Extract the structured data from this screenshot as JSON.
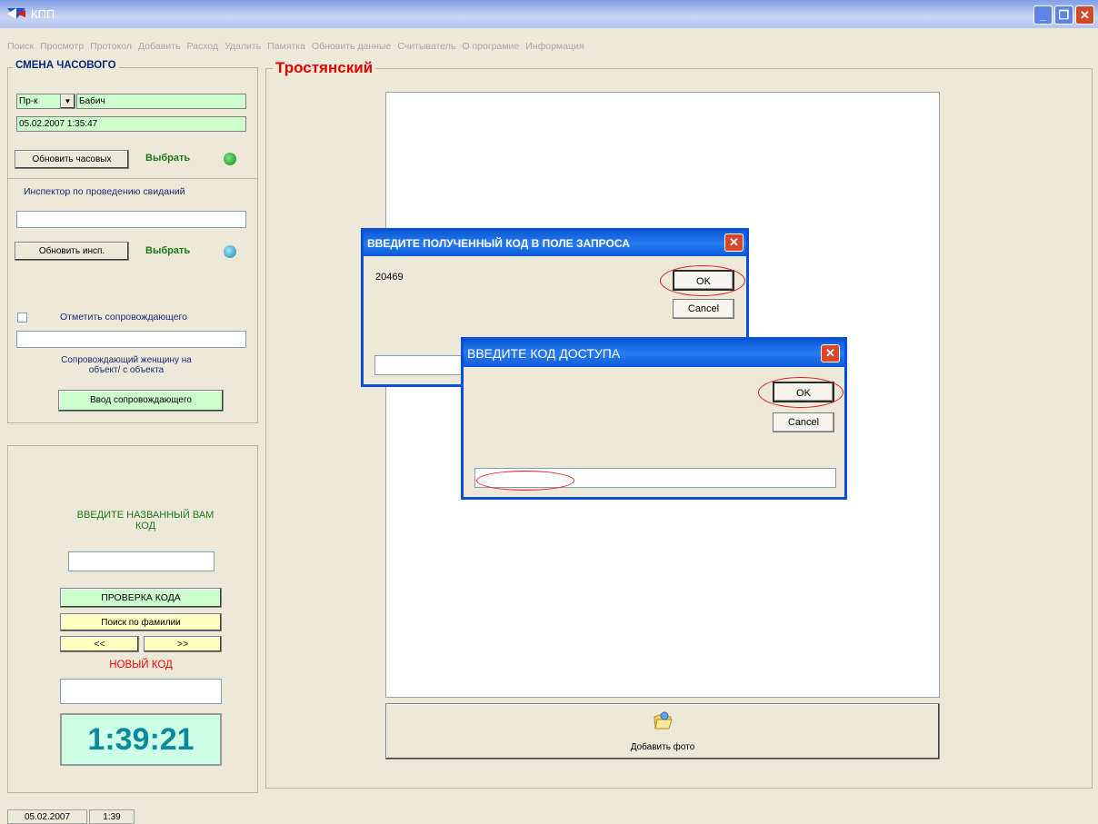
{
  "window": {
    "title": "КПП"
  },
  "menu": [
    "Поиск",
    "Просмотр",
    "Протокол",
    "Добавить",
    "Расход",
    "Удалить",
    "Памятка",
    "Обновить данные",
    "Считыватель",
    "О програмие",
    "Информация"
  ],
  "shift": {
    "legend": "СМЕНА ЧАСОВОГО",
    "combo_value": "Пр-к",
    "guard_name": "Бабич",
    "datetime": "05.02.2007 1:35:47",
    "update_guards_label": "Обновить часовых",
    "select_label": "Выбрать",
    "inspector_label": "Инспектор по проведению свиданий",
    "inspector_value": "",
    "update_inspector_label": "Обновить инсп.",
    "select_label2": "Выбрать",
    "escort_check_label": "Отметить сопровождающего",
    "escort_value": "",
    "escort_note": "Сопровождающий женщину на объект/ с объекта",
    "escort_button": "Ввод сопровождающего"
  },
  "code_panel": {
    "prompt": "ВВЕДИТЕ НАЗВАННЫЙ ВАМ КОД",
    "code_value": "",
    "check_button": "ПРОВЕРКА КОДА",
    "search_button": "Поиск по фамилии",
    "prev_button": "<<",
    "next_button": ">>",
    "new_code_label": "НОВЫЙ КОД",
    "new_code_value": "",
    "clock": "1:39:21"
  },
  "main": {
    "title": "Тростянский",
    "add_photo_label": "Добавить фото"
  },
  "dialog1": {
    "title": "ВВЕДИТЕ ПОЛУЧЕННЫЙ КОД  В ПОЛЕ ЗАПРОСА",
    "code": "20469",
    "ok": "OK",
    "cancel": "Cancel",
    "input_value": ""
  },
  "dialog2": {
    "title": "ВВЕДИТЕ  КОД ДОСТУПА",
    "ok": "OK",
    "cancel": "Cancel",
    "input_value": ""
  },
  "statusbar": {
    "date": "05.02.2007",
    "time": "1:39"
  },
  "colors": {
    "green_label": "#1a7a1a",
    "red_label": "#ff0000",
    "title_red": "#e00000",
    "clock_text": "#0a8a9a",
    "clock_bg": "#ccffe6"
  }
}
